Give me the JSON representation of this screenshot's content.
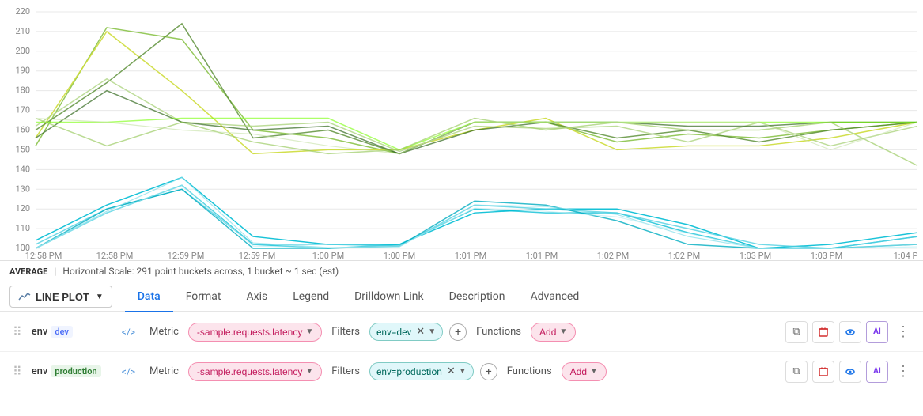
{
  "chart": {
    "yAxis": [
      "220",
      "210",
      "200",
      "190",
      "180",
      "170",
      "160",
      "150",
      "140",
      "130",
      "120",
      "110",
      "100"
    ],
    "xAxis": [
      "12:58 PM",
      "12:58 PM",
      "12:59 PM",
      "12:59 PM",
      "1:00 PM",
      "1:00 PM",
      "1:01 PM",
      "1:01 PM",
      "1:02 PM",
      "1:02 PM",
      "1:03 PM",
      "1:03 PM",
      "1:04 P"
    ]
  },
  "avgBar": {
    "label": "AVERAGE",
    "separator": "|",
    "text": "Horizontal Scale: 291 point buckets across, 1 bucket ~ 1 sec (est)"
  },
  "chartTypeBtn": {
    "label": "LINE PLOT",
    "icon": "line-chart-icon"
  },
  "tabs": [
    {
      "id": "data",
      "label": "Data",
      "active": true
    },
    {
      "id": "format",
      "label": "Format",
      "active": false
    },
    {
      "id": "axis",
      "label": "Axis",
      "active": false
    },
    {
      "id": "legend",
      "label": "Legend",
      "active": false
    },
    {
      "id": "drilldown",
      "label": "Drilldown Link",
      "active": false
    },
    {
      "id": "description",
      "label": "Description",
      "active": false
    },
    {
      "id": "advanced",
      "label": "Advanced",
      "active": false
    }
  ],
  "rows": [
    {
      "id": "row1",
      "env": "env",
      "envTag": "dev",
      "metric": {
        "label": "Metric",
        "value": "-sample.requests.latency"
      },
      "filter": {
        "label": "Filters",
        "chip": "env=dev"
      },
      "functions": {
        "label": "Functions",
        "value": "Add"
      }
    },
    {
      "id": "row2",
      "env": "env",
      "envTag": "production",
      "metric": {
        "label": "Metric",
        "value": "-sample.requests.latency"
      },
      "filter": {
        "label": "Filters",
        "chip": "env=production"
      },
      "functions": {
        "label": "Functions",
        "value": "Add"
      }
    }
  ],
  "actions": {
    "copy": "⧉",
    "delete": "🗑",
    "eye": "👁",
    "ai": "AI",
    "more": "⋮"
  }
}
